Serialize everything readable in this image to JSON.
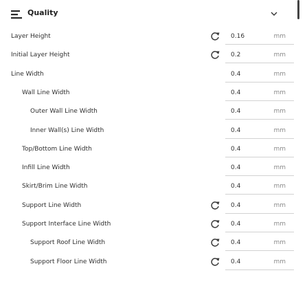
{
  "header": {
    "title": "Quality",
    "icon": "quality-icon",
    "collapse_icon": "chevron-down-icon"
  },
  "settings": [
    {
      "key": "layer-height",
      "label": "Layer Height",
      "value": "0.16",
      "unit": "mm",
      "indent": 0,
      "reset": true
    },
    {
      "key": "initial-layer-height",
      "label": "Initial Layer Height",
      "value": "0.2",
      "unit": "mm",
      "indent": 0,
      "reset": true
    },
    {
      "key": "line-width",
      "label": "Line Width",
      "value": "0.4",
      "unit": "mm",
      "indent": 0,
      "reset": false
    },
    {
      "key": "wall-line-width",
      "label": "Wall Line Width",
      "value": "0.4",
      "unit": "mm",
      "indent": 1,
      "reset": false
    },
    {
      "key": "outer-wall-line-width",
      "label": "Outer Wall Line Width",
      "value": "0.4",
      "unit": "mm",
      "indent": 2,
      "reset": false
    },
    {
      "key": "inner-walls-line-width",
      "label": "Inner Wall(s) Line Width",
      "value": "0.4",
      "unit": "mm",
      "indent": 2,
      "reset": false
    },
    {
      "key": "top-bottom-line-width",
      "label": "Top/Bottom Line Width",
      "value": "0.4",
      "unit": "mm",
      "indent": 1,
      "reset": false
    },
    {
      "key": "infill-line-width",
      "label": "Infill Line Width",
      "value": "0.4",
      "unit": "mm",
      "indent": 1,
      "reset": false
    },
    {
      "key": "skirt-brim-line-width",
      "label": "Skirt/Brim Line Width",
      "value": "0.4",
      "unit": "mm",
      "indent": 1,
      "reset": false
    },
    {
      "key": "support-line-width",
      "label": "Support Line Width",
      "value": "0.4",
      "unit": "mm",
      "indent": 1,
      "reset": true
    },
    {
      "key": "support-interface-line-width",
      "label": "Support Interface Line Width",
      "value": "0.4",
      "unit": "mm",
      "indent": 1,
      "reset": true
    },
    {
      "key": "support-roof-line-width",
      "label": "Support Roof Line Width",
      "value": "0.4",
      "unit": "mm",
      "indent": 2,
      "reset": true
    },
    {
      "key": "support-floor-line-width",
      "label": "Support Floor Line Width",
      "value": "0.4",
      "unit": "mm",
      "indent": 2,
      "reset": true
    }
  ],
  "icons": {
    "reset": "reset-arrow-icon"
  },
  "colors": {
    "text": "#2f2f2f",
    "unit": "#8a8a8a",
    "divider": "#d2d2d2",
    "icon": "#3a3a3a"
  }
}
